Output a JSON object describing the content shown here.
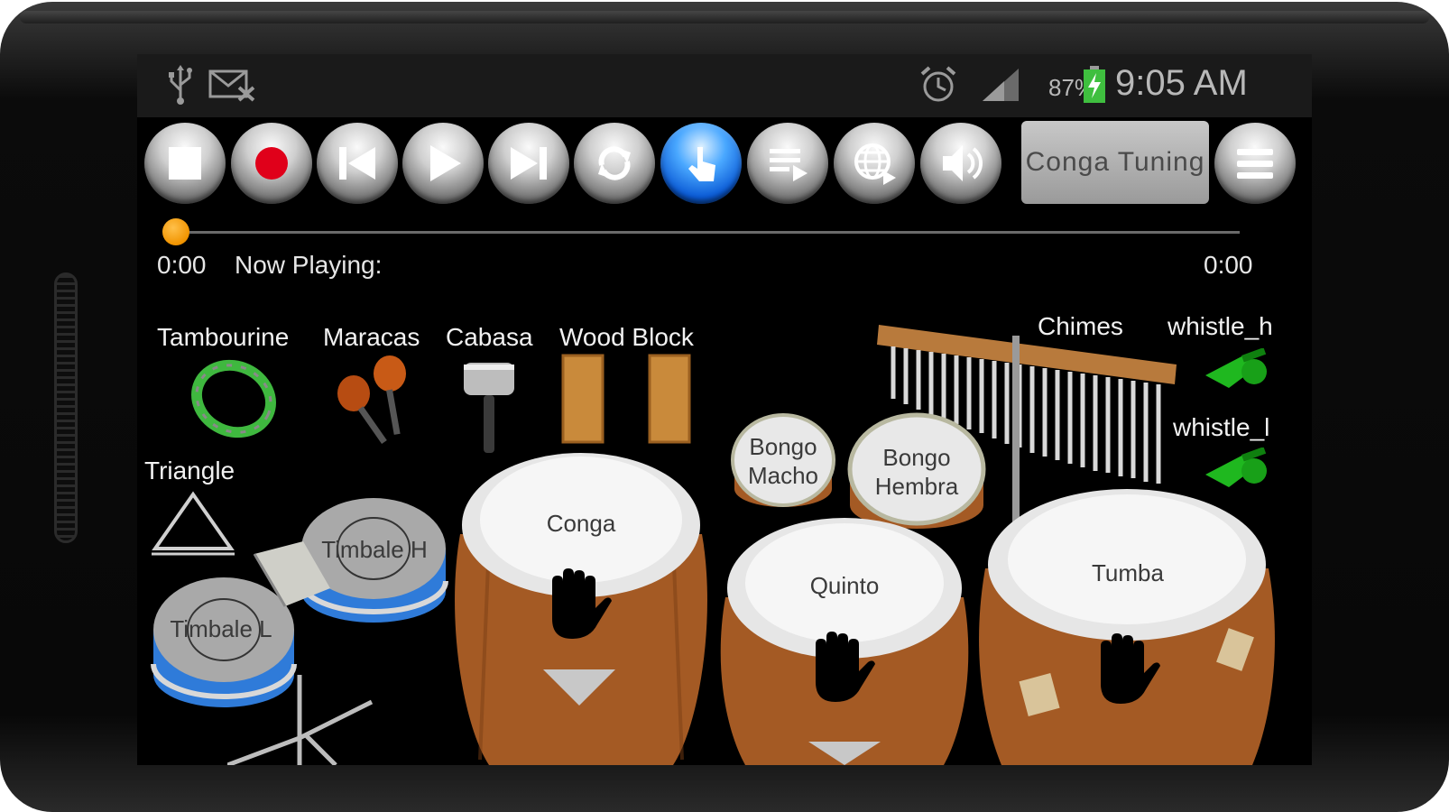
{
  "status_bar": {
    "battery_percent": "87%",
    "time": "9:05 AM",
    "icons": [
      "usb-icon",
      "missed-mail-icon",
      "alarm-icon",
      "signal-icon",
      "battery-charging-icon"
    ]
  },
  "toolbar": {
    "buttons": [
      "stop-icon",
      "record-icon",
      "previous-icon",
      "play-icon",
      "next-icon",
      "loop-icon",
      "touch-icon",
      "playlist-icon",
      "online-icon",
      "volume-icon",
      "menu-icon"
    ],
    "tuning_label": "Conga Tuning"
  },
  "player": {
    "progress": 0,
    "time_start": "0:00",
    "now_playing_label": "Now Playing:",
    "time_end": "0:00"
  },
  "instruments": {
    "tambourine": "Tambourine",
    "maracas": "Maracas",
    "cabasa": "Cabasa",
    "wood_block": "Wood Block",
    "chimes": "Chimes",
    "whistle_high": "whistle_h",
    "whistle_low": "whistle_l",
    "triangle": "Triangle"
  },
  "drums": {
    "bongo_macho_1": "Bongo",
    "bongo_macho_2": "Macho",
    "bongo_hembra_1": "Bongo",
    "bongo_hembra_2": "Hembra",
    "conga": "Conga",
    "quinto": "Quinto",
    "tumba": "Tumba",
    "timbale_h": "Timbale H",
    "timbale_l": "Timbale L"
  },
  "colors": {
    "accent_orange": "#f19400",
    "active_blue": "#1e7be6",
    "record_red": "#e0001a",
    "whistle_green": "#1fb81f"
  }
}
